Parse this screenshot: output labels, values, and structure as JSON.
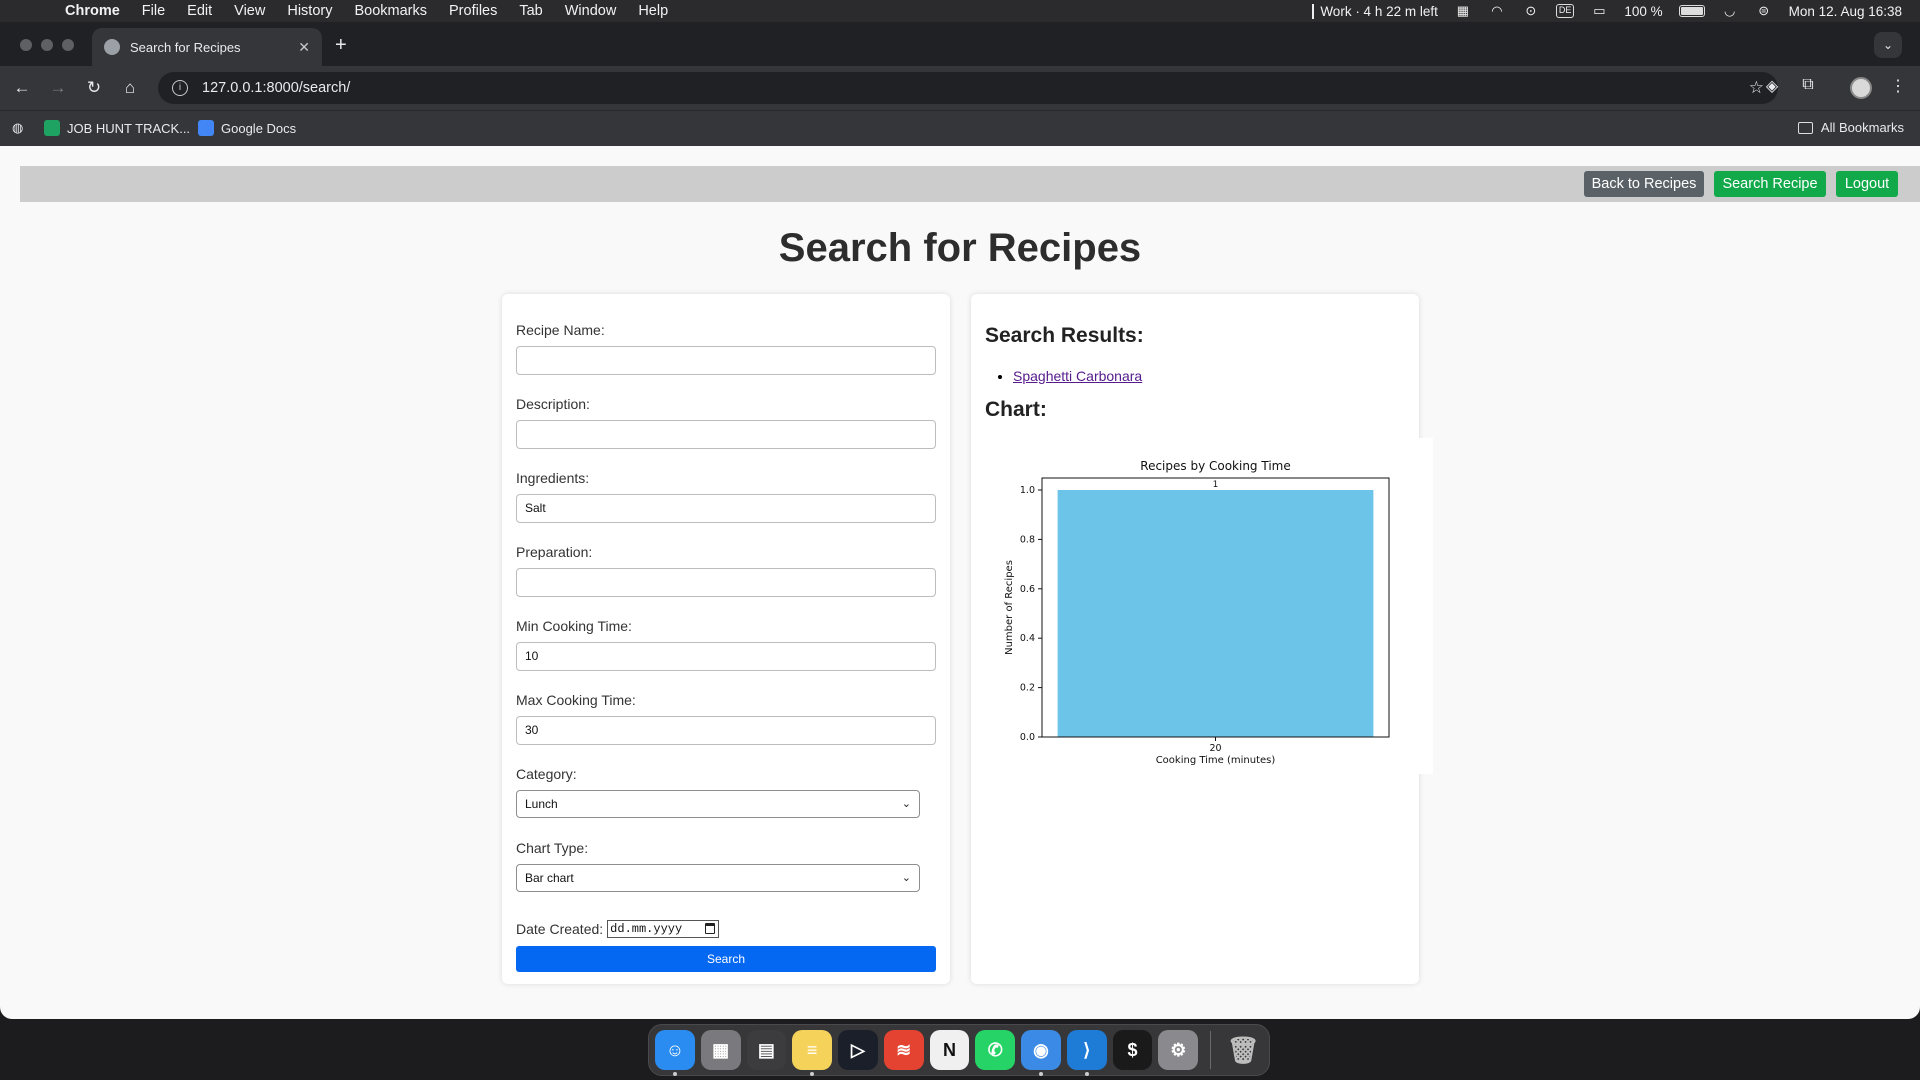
{
  "menubar": {
    "app": "Chrome",
    "items": [
      "File",
      "Edit",
      "View",
      "History",
      "Bookmarks",
      "Profiles",
      "Tab",
      "Window",
      "Help"
    ],
    "work_timer": "Work · 4 h 22 m left",
    "keyboard_layout": "DE",
    "battery": "100 %",
    "datetime": "Mon 12. Aug  16:38"
  },
  "browser": {
    "tab_title": "Search for Recipes",
    "url": "127.0.0.1:8000/search/",
    "bookmarks": [
      {
        "label": "JOB HUNT TRACK...",
        "icon": "sheets-icon",
        "color": "#1ea362"
      },
      {
        "label": "Google Docs",
        "icon": "docs-icon",
        "color": "#4285f4"
      }
    ],
    "all_bookmarks": "All Bookmarks"
  },
  "nav": {
    "back_label": "Back to Recipes",
    "search_label": "Search Recipe",
    "logout_label": "Logout"
  },
  "page": {
    "title": "Search for Recipes"
  },
  "form": {
    "recipe_name_label": "Recipe Name:",
    "recipe_name_value": "",
    "description_label": "Description:",
    "description_value": "",
    "ingredients_label": "Ingredients:",
    "ingredients_value": "Salt",
    "preparation_label": "Preparation:",
    "preparation_value": "",
    "min_time_label": "Min Cooking Time:",
    "min_time_value": "10",
    "max_time_label": "Max Cooking Time:",
    "max_time_value": "30",
    "category_label": "Category:",
    "category_value": "Lunch",
    "chart_type_label": "Chart Type:",
    "chart_type_value": "Bar chart",
    "date_label": "Date Created:",
    "date_placeholder": "dd.mm.yyyy",
    "submit_label": "Search"
  },
  "results": {
    "heading": "Search Results:",
    "items": [
      "Spaghetti Carbonara"
    ],
    "chart_heading": "Chart:"
  },
  "chart_data": {
    "type": "bar",
    "title": "Recipes by Cooking Time",
    "xlabel": "Cooking Time (minutes)",
    "ylabel": "Number of Recipes",
    "categories": [
      "20"
    ],
    "values": [
      1
    ],
    "data_labels": [
      "1"
    ],
    "ylim": [
      0,
      1.0
    ],
    "yticks": [
      "0.0",
      "0.2",
      "0.4",
      "0.6",
      "0.8",
      "1.0"
    ],
    "bar_color": "#6cc4e8",
    "grid": false
  },
  "dock": {
    "apps": [
      {
        "name": "finder-icon",
        "glyph": "☺",
        "color": "#2a8cf0",
        "running": true
      },
      {
        "name": "launchpad-icon",
        "glyph": "▦",
        "color": "#7a7a7e",
        "running": false
      },
      {
        "name": "calculator-icon",
        "glyph": "▤",
        "color": "#3c3c3e",
        "running": false
      },
      {
        "name": "notes-icon",
        "glyph": "≡",
        "color": "#f5d35a",
        "running": true
      },
      {
        "name": "cursor-icon",
        "glyph": "▷",
        "color": "#1b1f2a",
        "running": false
      },
      {
        "name": "todoist-icon",
        "glyph": "≋",
        "color": "#e44332",
        "running": false
      },
      {
        "name": "notion-icon",
        "glyph": "N",
        "color": "#f0f0f0",
        "running": false
      },
      {
        "name": "whatsapp-icon",
        "glyph": "✆",
        "color": "#25d366",
        "running": false
      },
      {
        "name": "chrome-icon",
        "glyph": "◉",
        "color": "#3b8ae6",
        "running": true
      },
      {
        "name": "vscode-icon",
        "glyph": "⟩",
        "color": "#1e7bd6",
        "running": true
      },
      {
        "name": "terminal-icon",
        "glyph": "$",
        "color": "#1a1a1a",
        "running": false
      },
      {
        "name": "settings-icon",
        "glyph": "⚙",
        "color": "#8a8a8e",
        "running": false
      }
    ],
    "trash": {
      "name": "trash-icon",
      "glyph": "🗑",
      "color": "#bdbdbd"
    }
  }
}
